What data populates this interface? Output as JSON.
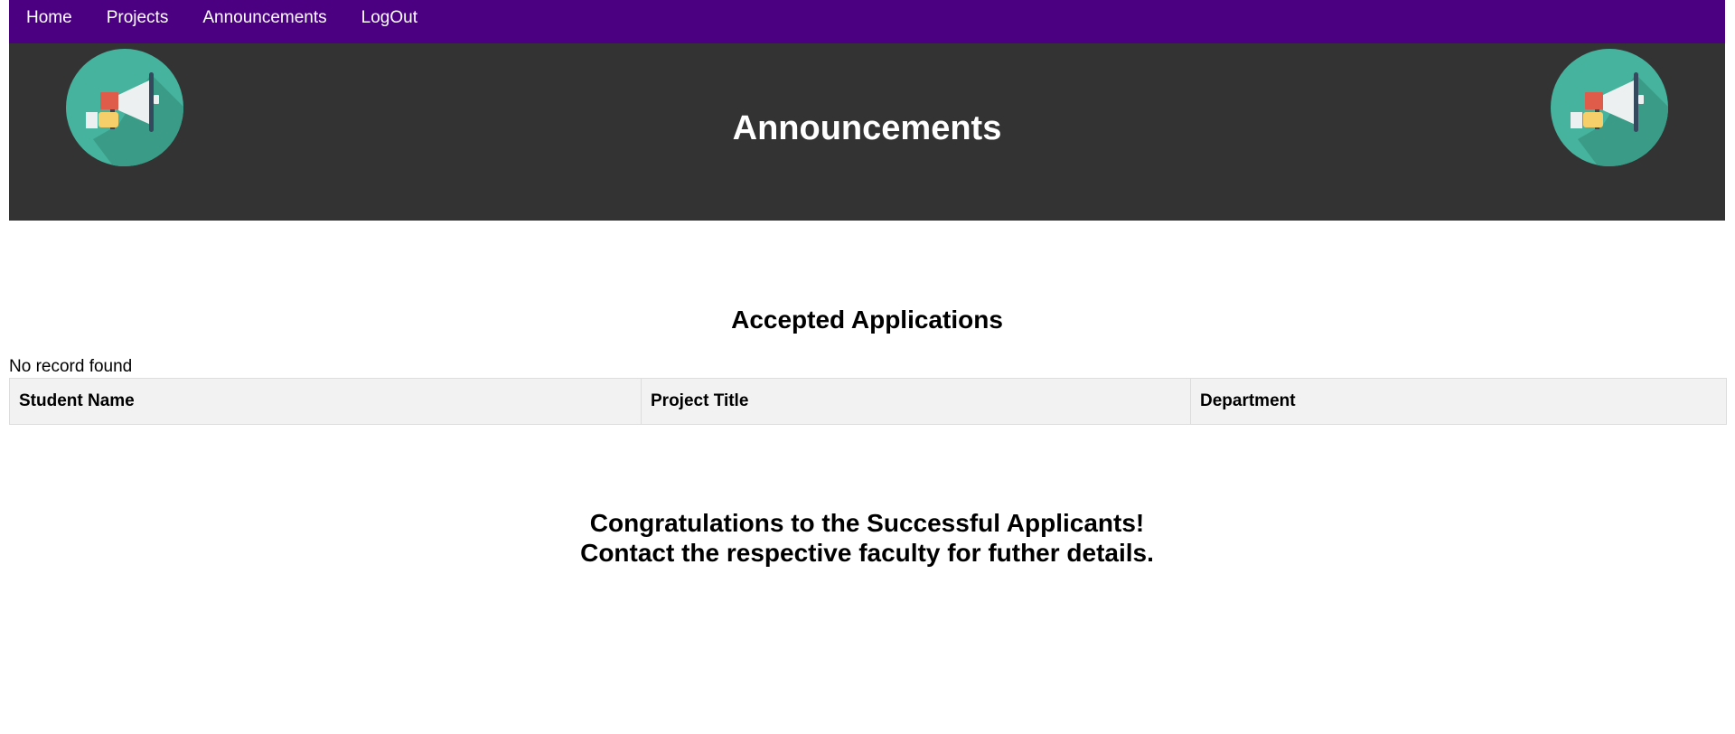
{
  "nav": {
    "items": [
      {
        "label": "Home"
      },
      {
        "label": "Projects"
      },
      {
        "label": "Announcements"
      },
      {
        "label": "LogOut"
      }
    ],
    "bg_color": "#4b0082"
  },
  "banner": {
    "title": "Announcements",
    "icon": "megaphone-icon",
    "bg_color": "#333333"
  },
  "main": {
    "heading": "Accepted Applications",
    "empty_message": "No record found",
    "table": {
      "columns": [
        "Student Name",
        "Project Title",
        "Department"
      ],
      "rows": []
    },
    "congrats": {
      "line1": "Congratulations to the Successful Applicants!",
      "line2": "Contact the respective faculty for futher details."
    }
  }
}
